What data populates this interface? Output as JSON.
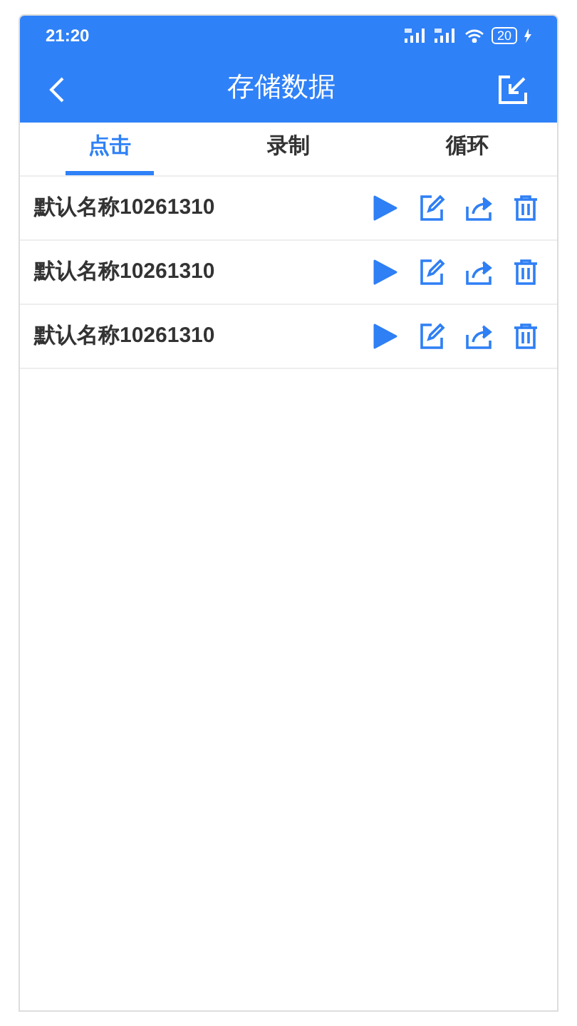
{
  "status_bar": {
    "time": "21:20",
    "battery": "20"
  },
  "header": {
    "title": "存储数据"
  },
  "tabs": [
    {
      "label": "点击",
      "selected": true
    },
    {
      "label": "录制",
      "selected": false
    },
    {
      "label": "循环",
      "selected": false
    }
  ],
  "records": [
    {
      "name": "默认名称10261310"
    },
    {
      "name": "默认名称10261310"
    },
    {
      "name": "默认名称10261310"
    }
  ]
}
